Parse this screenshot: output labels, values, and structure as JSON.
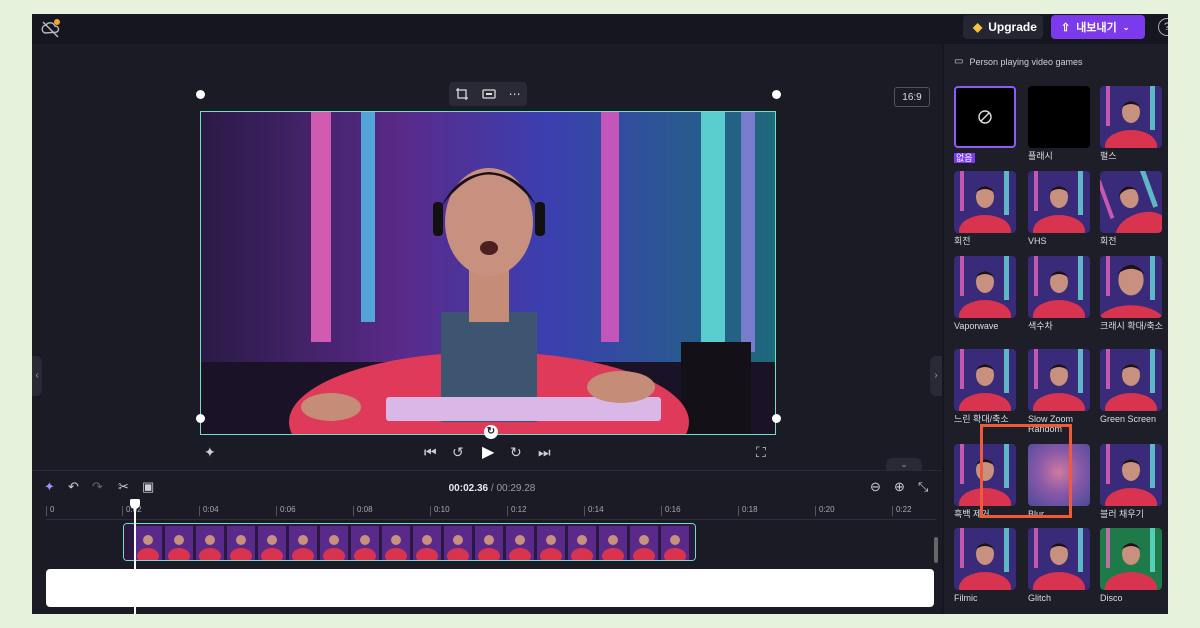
{
  "topbar": {
    "upgrade_label": "Upgrade",
    "export_label": "내보내기"
  },
  "preview": {
    "ratio": "16:9"
  },
  "timeline": {
    "current_time": "00:02.36",
    "total_time": "/ 00:29.28",
    "ticks": [
      "0",
      "0:02",
      "0:04",
      "0:06",
      "0:08",
      "0:10",
      "0:12",
      "0:14",
      "0:16",
      "0:18",
      "0:20",
      "0:22"
    ]
  },
  "side": {
    "title": "Person playing video games",
    "effects": [
      {
        "label": "없음"
      },
      {
        "label": "플래시"
      },
      {
        "label": "펄스"
      },
      {
        "label": "회전"
      },
      {
        "label": "VHS"
      },
      {
        "label": "회전"
      },
      {
        "label": "Vaporwave"
      },
      {
        "label": "색수차"
      },
      {
        "label": "크래시 확대/축소"
      },
      {
        "label": "느린 확대/축소"
      },
      {
        "label": "Slow Zoom Random"
      },
      {
        "label": "Green Screen"
      },
      {
        "label": "흑백 제거"
      },
      {
        "label": "Blur"
      },
      {
        "label": "블러 채우기"
      },
      {
        "label": "Filmic"
      },
      {
        "label": "Glitch"
      },
      {
        "label": "Disco"
      }
    ]
  },
  "colors": {
    "accent": "#7c3aed",
    "selection": "#6fe0c6",
    "highlight": "#f05a38"
  }
}
